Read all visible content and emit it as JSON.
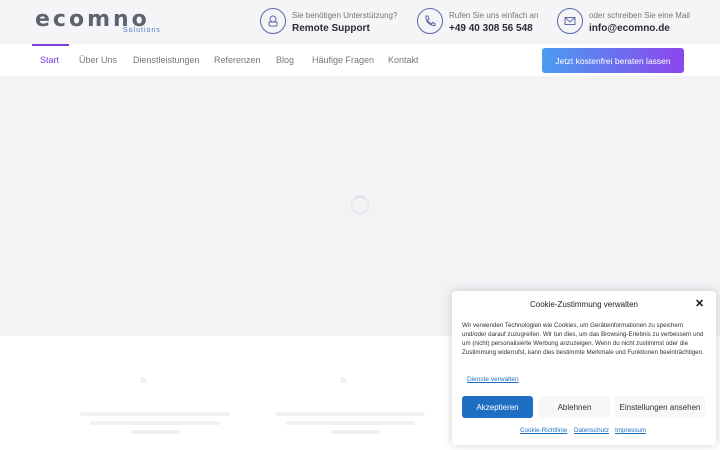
{
  "logo": {
    "wordmark": "ecomno",
    "subtitle": "Solutions"
  },
  "contacts": [
    {
      "icon": "support-icon",
      "label": "Sie benötigen Unterstützung?",
      "value": "Remote Support"
    },
    {
      "icon": "phone-icon",
      "label": "Rufen Sie uns einfach an",
      "value": "+49 40 308 56 548"
    },
    {
      "icon": "mail-icon",
      "label": "oder schreiben Sie eine Mail",
      "value": "info@ecomno.de"
    }
  ],
  "nav": {
    "items": [
      "Start",
      "Über Uns",
      "Dienstleistungen",
      "Referenzen",
      "Blog",
      "Häufige Fragen",
      "Kontakt"
    ],
    "active": "Start",
    "cta": "Jetzt kostenfrei beraten lassen"
  },
  "cookie": {
    "title": "Cookie-Zustimmung verwalten",
    "text": "Wir verwenden Technologien wie Cookies, um Geräteinformationen zu speichern und/oder darauf zuzugreifen. Wir tun dies, um das Browsing-Erlebnis zu verbessern und um (nicht) personalisierte Werbung anzuzeigen. Wenn du nicht zustimmst oder die Zustimmung widerrufst, kann dies bestimmte Merkmale und Funktionen beeinträchtigen.",
    "services_link": "Dienste verwalten",
    "accept": "Akzeptieren",
    "deny": "Ablehnen",
    "settings": "Einstellungen ansehen",
    "footer_links": [
      "Cookie-Richtlinie",
      "Datenschutz",
      "Impressum"
    ]
  },
  "colors": {
    "accent": "#7b3fe0",
    "link": "#1e6fc4",
    "cta_start": "#4c9cf0",
    "cta_end": "#8b46ec"
  }
}
